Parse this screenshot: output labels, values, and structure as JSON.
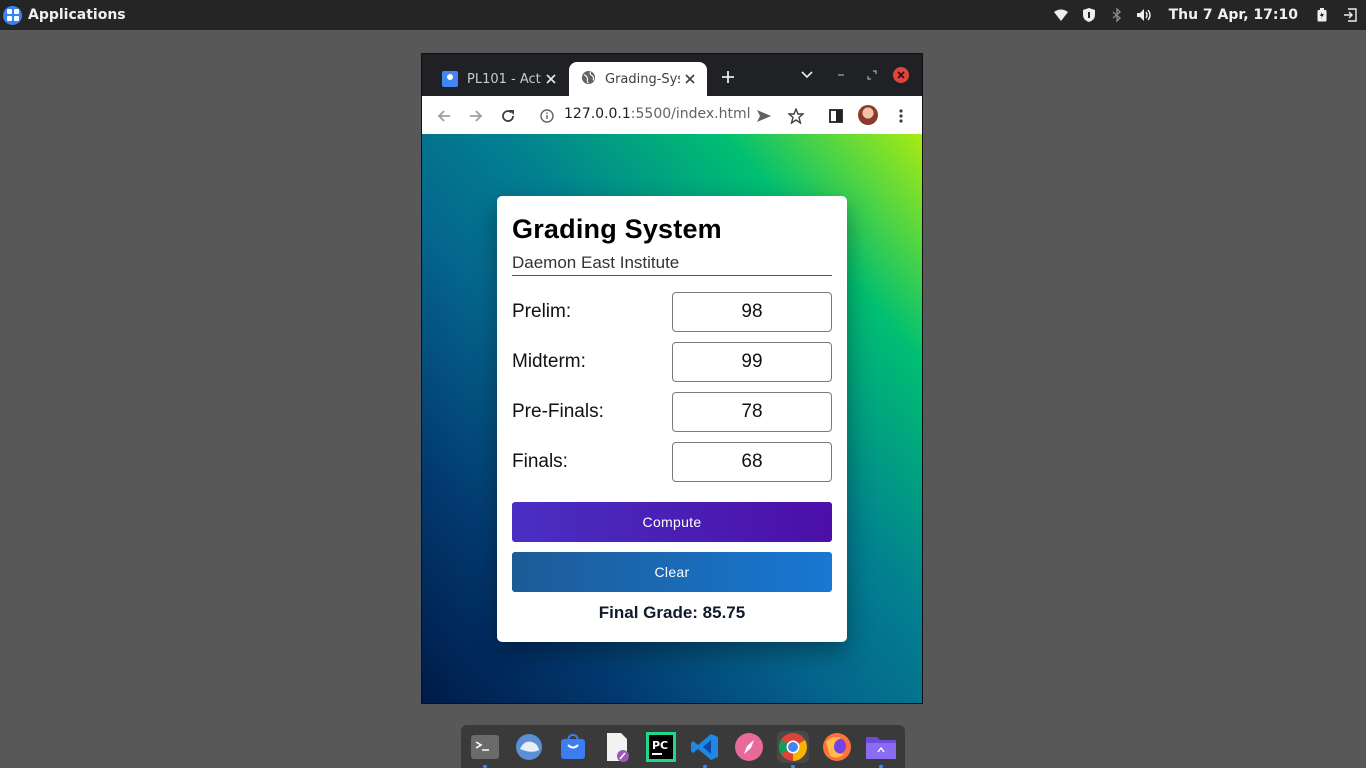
{
  "top_panel": {
    "apps_label": "Applications",
    "clock": "Thu  7 Apr, 17:10",
    "icons": [
      "wifi-icon",
      "security-icon",
      "bluetooth-icon",
      "volume-icon",
      "battery-icon",
      "logout-icon"
    ]
  },
  "browser": {
    "tabs": [
      {
        "title": "PL101 - Activ",
        "active": false,
        "icon": "classroom-icon"
      },
      {
        "title": "Grading-Syst",
        "active": true,
        "icon": "globe-icon"
      }
    ],
    "url_host": "127.0.0.1",
    "url_rest": ":5500/index.html"
  },
  "page": {
    "title": "Grading System",
    "subtitle": "Daemon East Institute",
    "fields": [
      {
        "label": "Prelim:",
        "value": "98"
      },
      {
        "label": "Midterm:",
        "value": "99"
      },
      {
        "label": "Pre-Finals:",
        "value": "78"
      },
      {
        "label": "Finals:",
        "value": "68"
      }
    ],
    "compute_label": "Compute",
    "clear_label": "Clear",
    "final_grade": "Final Grade: 85.75"
  },
  "colors": {
    "compute_button": "#4a2fc3",
    "clear_button": "#1878d3",
    "gradient_start": "#001b48",
    "gradient_end": "#a8eb12"
  },
  "dock": {
    "items": [
      "terminal-icon",
      "mail-icon",
      "store-icon",
      "text-editor-icon",
      "pycharm-icon",
      "vscode-icon",
      "compass-icon",
      "chrome-icon",
      "firefox-icon",
      "folder-icon"
    ]
  }
}
